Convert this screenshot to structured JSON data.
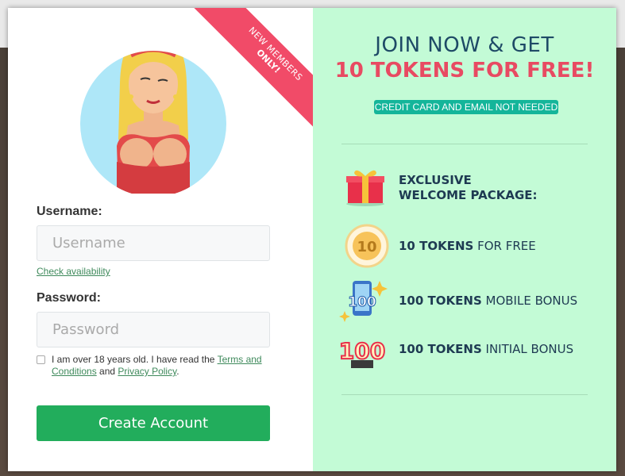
{
  "modal": {
    "ribbon": {
      "line1": "NEW MEMBERS",
      "line2": "ONLY!"
    },
    "form": {
      "username_label": "Username:",
      "username_placeholder": "Username",
      "check_availability": "Check availability",
      "password_label": "Password:",
      "password_placeholder": "Password",
      "agree_text_1": "I am over 18 years old. I have read the ",
      "terms_link": "Terms and Conditions",
      "agree_text_2": " and ",
      "privacy_link": "Privacy Policy",
      "agree_text_3": ".",
      "submit_label": "Create Account"
    },
    "promo": {
      "headline_1": "JOIN NOW & GET",
      "headline_2": "10 TOKENS FOR FREE!",
      "pill": "CREDIT CARD AND EMAIL NOT NEEDED",
      "benefits": [
        {
          "icon": "gift-icon",
          "bold": "EXCLUSIVE",
          "bold2": "WELCOME PACKAGE:",
          "rest": ""
        },
        {
          "icon": "coin-10-icon",
          "bold": "10 TOKENS",
          "rest": " FOR FREE"
        },
        {
          "icon": "phone-100-icon",
          "bold": "100 TOKENS",
          "rest": " MOBILE BONUS"
        },
        {
          "icon": "badge-100-icon",
          "bold": "100 TOKENS",
          "rest": " INITIAL BONUS"
        }
      ],
      "coin_text": "10",
      "phone_badge_text": "100",
      "badge_text": "100"
    },
    "colors": {
      "accent_green": "#22ad5c",
      "promo_bg": "#c3fbd6",
      "ribbon_pink": "#f14b68",
      "headline_pink": "#e84a62",
      "navy": "#1e4a66"
    }
  }
}
